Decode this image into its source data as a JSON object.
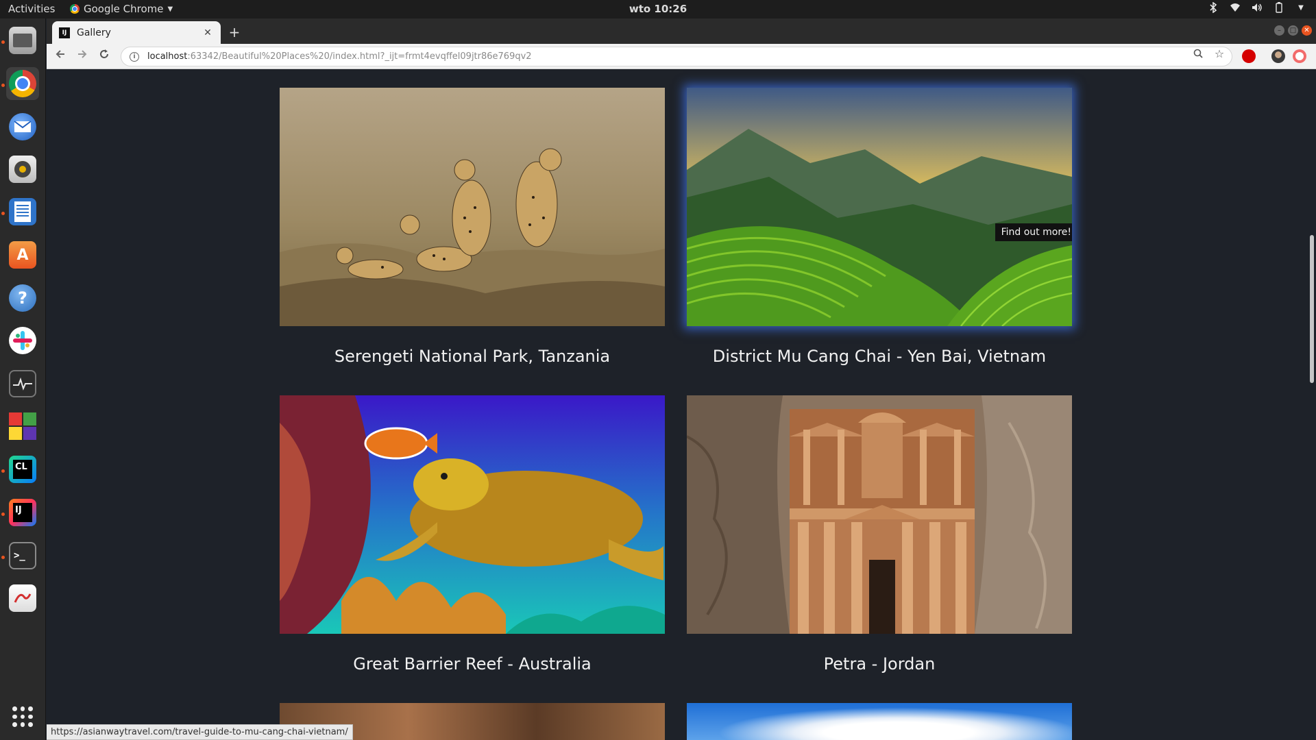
{
  "topbar": {
    "activities": "Activities",
    "app_name": "Google Chrome",
    "clock": "wto 10:26"
  },
  "dock": {
    "items": [
      {
        "name": "files-icon"
      },
      {
        "name": "chrome-icon"
      },
      {
        "name": "thunderbird-icon"
      },
      {
        "name": "rhythmbox-icon"
      },
      {
        "name": "writer-icon"
      },
      {
        "name": "software-icon"
      },
      {
        "name": "help-icon"
      },
      {
        "name": "slack-icon"
      },
      {
        "name": "system-monitor-icon"
      },
      {
        "name": "windows-app-icon"
      },
      {
        "name": "clion-icon",
        "label": "CL"
      },
      {
        "name": "intellij-icon",
        "label": "IJ"
      },
      {
        "name": "terminal-icon",
        "label": ">_"
      },
      {
        "name": "pdf-viewer-icon"
      },
      {
        "name": "show-apps-icon"
      }
    ]
  },
  "browser": {
    "tab_title": "Gallery",
    "favicon_text": "IJ",
    "url_host": "localhost",
    "url_path": ":63342/Beautiful%20Places%20/index.html?_ijt=frmt4evqffel09jtr86e769qv2",
    "status_url": "https://asianwaytravel.com/travel-guide-to-mu-cang-chai-vietnam/"
  },
  "gallery": {
    "cards": [
      {
        "caption": "Serengeti National Park, Tanzania"
      },
      {
        "caption": "District Mu Cang Chai - Yen Bai, Vietnam",
        "tooltip": "Find out more!"
      },
      {
        "caption": "Great Barrier Reef - Australia"
      },
      {
        "caption": "Petra - Jordan"
      }
    ]
  },
  "colors": {
    "page_bg": "#1e2229",
    "hover_glow": "#3c6edc",
    "ubuntu_accent": "#e95420"
  }
}
